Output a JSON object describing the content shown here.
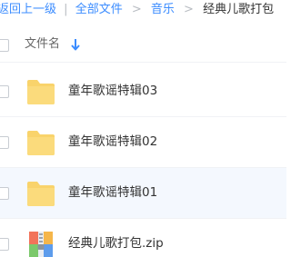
{
  "breadcrumb": {
    "back_label": "返回上一级",
    "separator": "|",
    "items": [
      {
        "label": "全部文件"
      },
      {
        "label": "音乐"
      }
    ],
    "arrow": ">",
    "current": "经典儿歌打包"
  },
  "list_header": {
    "name_label": "文件名",
    "sort_icon": "arrow-down-icon"
  },
  "files": [
    {
      "name": "童年歌谣特辑03",
      "type": "folder",
      "icon": "folder-icon"
    },
    {
      "name": "童年歌谣特辑02",
      "type": "folder",
      "icon": "folder-icon"
    },
    {
      "name": "童年歌谣特辑01",
      "type": "folder",
      "icon": "folder-icon"
    },
    {
      "name": "经典儿歌打包.zip",
      "type": "zip",
      "icon": "zip-icon"
    }
  ],
  "colors": {
    "link": "#3b8cff",
    "folder": "#f9d36b",
    "row_hover": "#f4f8fe",
    "text": "#333333"
  }
}
